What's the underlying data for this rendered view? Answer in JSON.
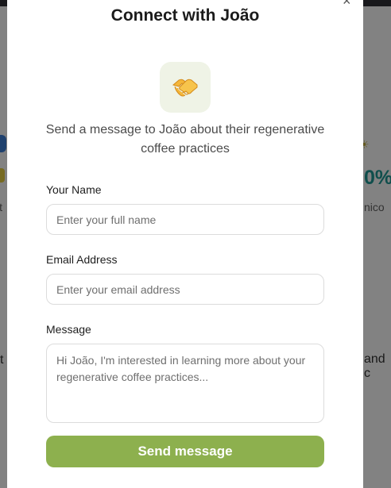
{
  "background": {
    "left_fragment": "lt",
    "left_fragment_2": "t",
    "right_percent": "0%",
    "right_fragment": "nico",
    "right_fragment_2": "and c"
  },
  "modal": {
    "title": "Connect with João",
    "close_label": "×",
    "icon": "handshake-icon",
    "subtitle": "Send a message to João about their regenerative coffee practices",
    "fields": {
      "name": {
        "label": "Your Name",
        "placeholder": "Enter your full name"
      },
      "email": {
        "label": "Email Address",
        "placeholder": "Enter your email address"
      },
      "message": {
        "label": "Message",
        "placeholder": "Hi João, I'm interested in learning more about your regenerative coffee practices..."
      }
    },
    "submit_label": "Send message"
  },
  "colors": {
    "accent": "#8db04e",
    "icon_tile_bg": "#eff3e6",
    "overlay": "rgba(0,0,0,0.45)"
  }
}
